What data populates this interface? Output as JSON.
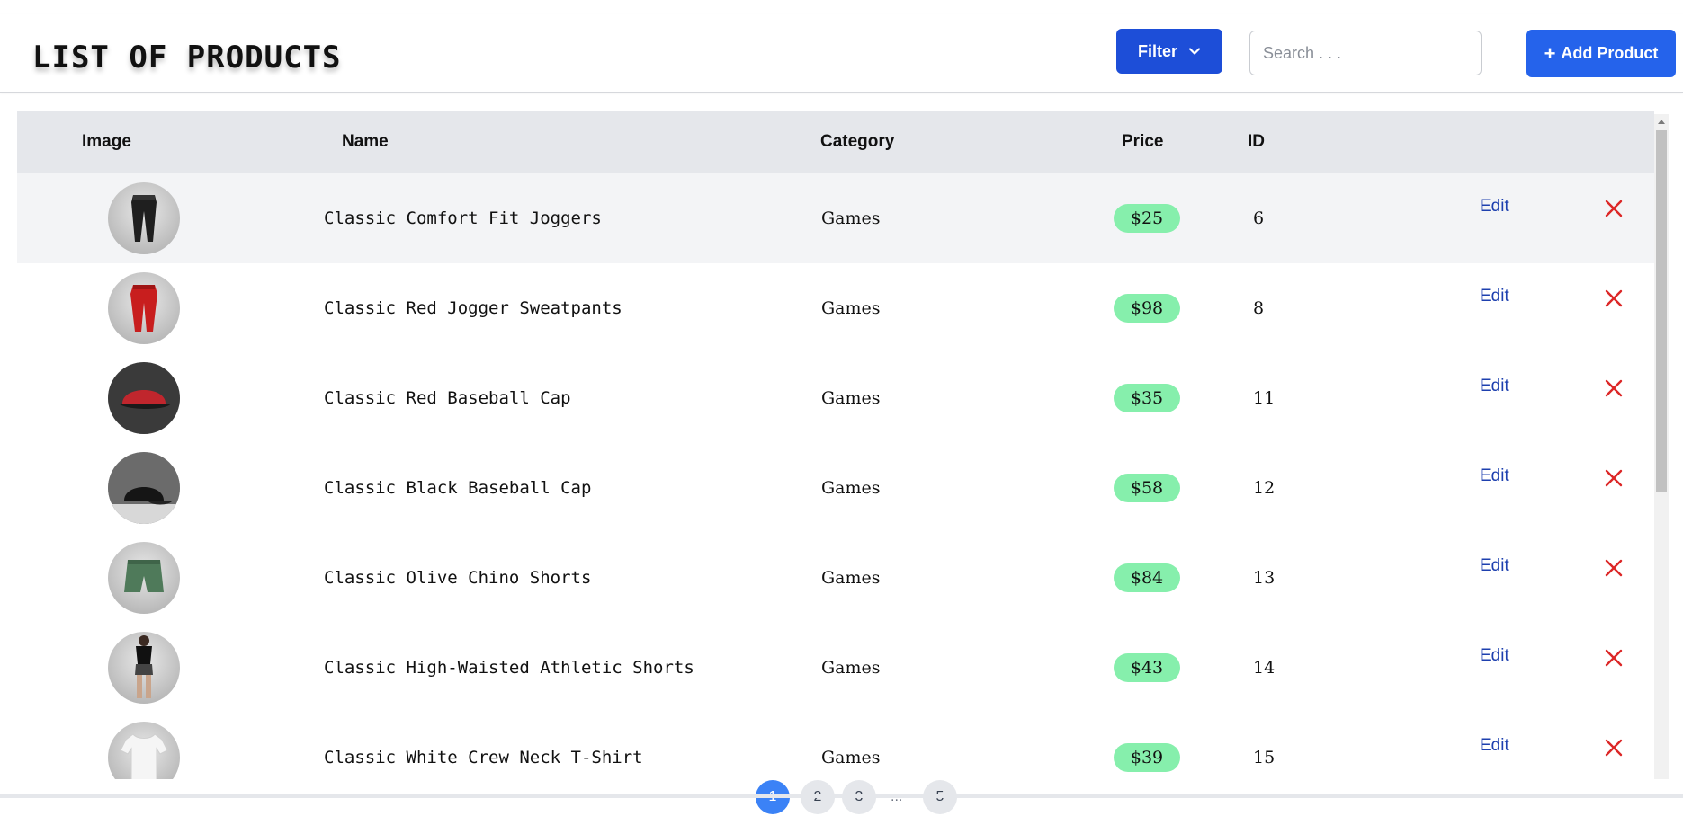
{
  "header": {
    "title": "LIST OF PRODUCTS",
    "filter_label": "Filter",
    "search_placeholder": "Search . . .",
    "add_label": "Add Product",
    "add_symbol": "+"
  },
  "table": {
    "columns": {
      "image": "Image",
      "name": "Name",
      "category": "Category",
      "price": "Price",
      "id": "ID"
    },
    "edit_label": "Edit",
    "rows": [
      {
        "image_icon": "joggers-black-icon",
        "name": "Classic Comfort Fit Joggers",
        "category": "Games",
        "price": "$25",
        "id": "6"
      },
      {
        "image_icon": "sweatpants-red-icon",
        "name": "Classic Red Jogger Sweatpants",
        "category": "Games",
        "price": "$98",
        "id": "8"
      },
      {
        "image_icon": "cap-red-icon",
        "name": "Classic Red Baseball Cap",
        "category": "Games",
        "price": "$35",
        "id": "11"
      },
      {
        "image_icon": "cap-black-icon",
        "name": "Classic Black Baseball Cap",
        "category": "Games",
        "price": "$58",
        "id": "12"
      },
      {
        "image_icon": "shorts-olive-icon",
        "name": "Classic Olive Chino Shorts",
        "category": "Games",
        "price": "$84",
        "id": "13"
      },
      {
        "image_icon": "athletic-shorts-icon",
        "name": "Classic High-Waisted Athletic Shorts",
        "category": "Games",
        "price": "$43",
        "id": "14"
      },
      {
        "image_icon": "tshirt-white-icon",
        "name": "Classic White Crew Neck T-Shirt",
        "category": "Games",
        "price": "$39",
        "id": "15"
      }
    ]
  },
  "pagination": {
    "pages": [
      "1",
      "2",
      "3",
      "5"
    ],
    "ellipsis": "...",
    "active": "1"
  },
  "colors": {
    "primary": "#1d4ed8",
    "add_button": "#2563eb",
    "price_badge": "#86efac",
    "delete": "#dc2626",
    "edit_link": "#1e40af",
    "header_row": "#e5e7eb"
  }
}
